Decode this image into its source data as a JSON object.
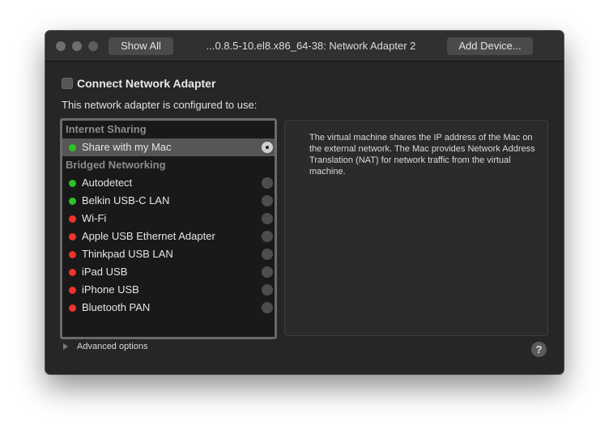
{
  "titlebar": {
    "show_all_label": "Show All",
    "title": "...0.8.5-10.el8.x86_64-38: Network Adapter 2",
    "add_device_label": "Add Device..."
  },
  "connect": {
    "label": "Connect Network Adapter",
    "checked": false
  },
  "configured_label": "This network adapter is configured to use:",
  "groups": [
    {
      "heading": "Internet Sharing",
      "items": [
        {
          "label": "Share with my Mac",
          "status": "green",
          "selected": true
        }
      ]
    },
    {
      "heading": "Bridged Networking",
      "items": [
        {
          "label": "Autodetect",
          "status": "green",
          "selected": false
        },
        {
          "label": "Belkin USB-C LAN",
          "status": "green",
          "selected": false
        },
        {
          "label": "Wi-Fi",
          "status": "red",
          "selected": false
        },
        {
          "label": "Apple USB Ethernet Adapter",
          "status": "red",
          "selected": false
        },
        {
          "label": "Thinkpad USB LAN",
          "status": "red",
          "selected": false
        },
        {
          "label": "iPad USB",
          "status": "red",
          "selected": false
        },
        {
          "label": "iPhone USB",
          "status": "red",
          "selected": false
        },
        {
          "label": "Bluetooth PAN",
          "status": "red",
          "selected": false
        }
      ]
    }
  ],
  "status_colors": {
    "green": "#2ec225",
    "red": "#f0322c"
  },
  "description": "The virtual machine shares the IP address of the Mac on the external network. The Mac provides Network Address Translation (NAT) for network traffic from the virtual machine.",
  "advanced_label": "Advanced options",
  "help_label": "?"
}
